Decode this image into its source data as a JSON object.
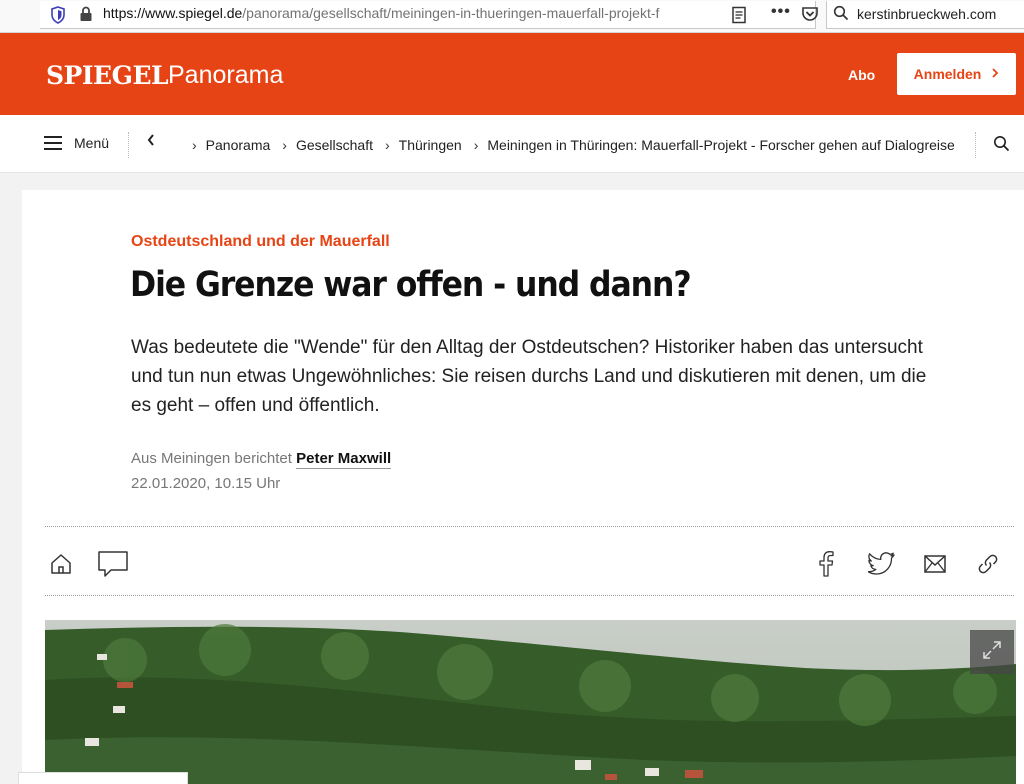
{
  "browser": {
    "url_host": "https://www.spiegel.de",
    "url_path": "/panorama/gesellschaft/meiningen-in-thueringen-mauerfall-projekt-f",
    "more_label": "•••",
    "search_text": "kerstinbrueckweh.com"
  },
  "header": {
    "logo": "SPIEGEL",
    "section": "Panorama",
    "abo_label": "Abo",
    "login_label": "Anmelden",
    "brand_color": "#e64415"
  },
  "nav": {
    "menu_label": "Menü",
    "breadcrumbs": [
      "Panorama",
      "Gesellschaft",
      "Thüringen",
      "Meiningen in Thüringen: Mauerfall-Projekt - Forscher gehen auf Dialogreise"
    ]
  },
  "article": {
    "kicker": "Ostdeutschland und der Mauerfall",
    "headline": "Die Grenze war offen - und dann?",
    "teaser": "Was bedeutete die \"Wende\" für den Alltag der Ostdeutschen? Historiker haben das untersucht und tun nun etwas Ungewöhnliches: Sie reisen durchs Land und diskutieren mit denen, um die es geht – offen und öffentlich.",
    "byline_prefix": "Aus Meiningen berichtet",
    "author": "Peter Maxwill",
    "date": "22.01.2020, 10.15 Uhr"
  },
  "icons": {
    "home": "home-icon",
    "comment": "comment-icon",
    "facebook": "facebook-icon",
    "twitter": "twitter-icon",
    "mail": "mail-icon",
    "link": "link-icon",
    "expand": "expand-icon"
  }
}
